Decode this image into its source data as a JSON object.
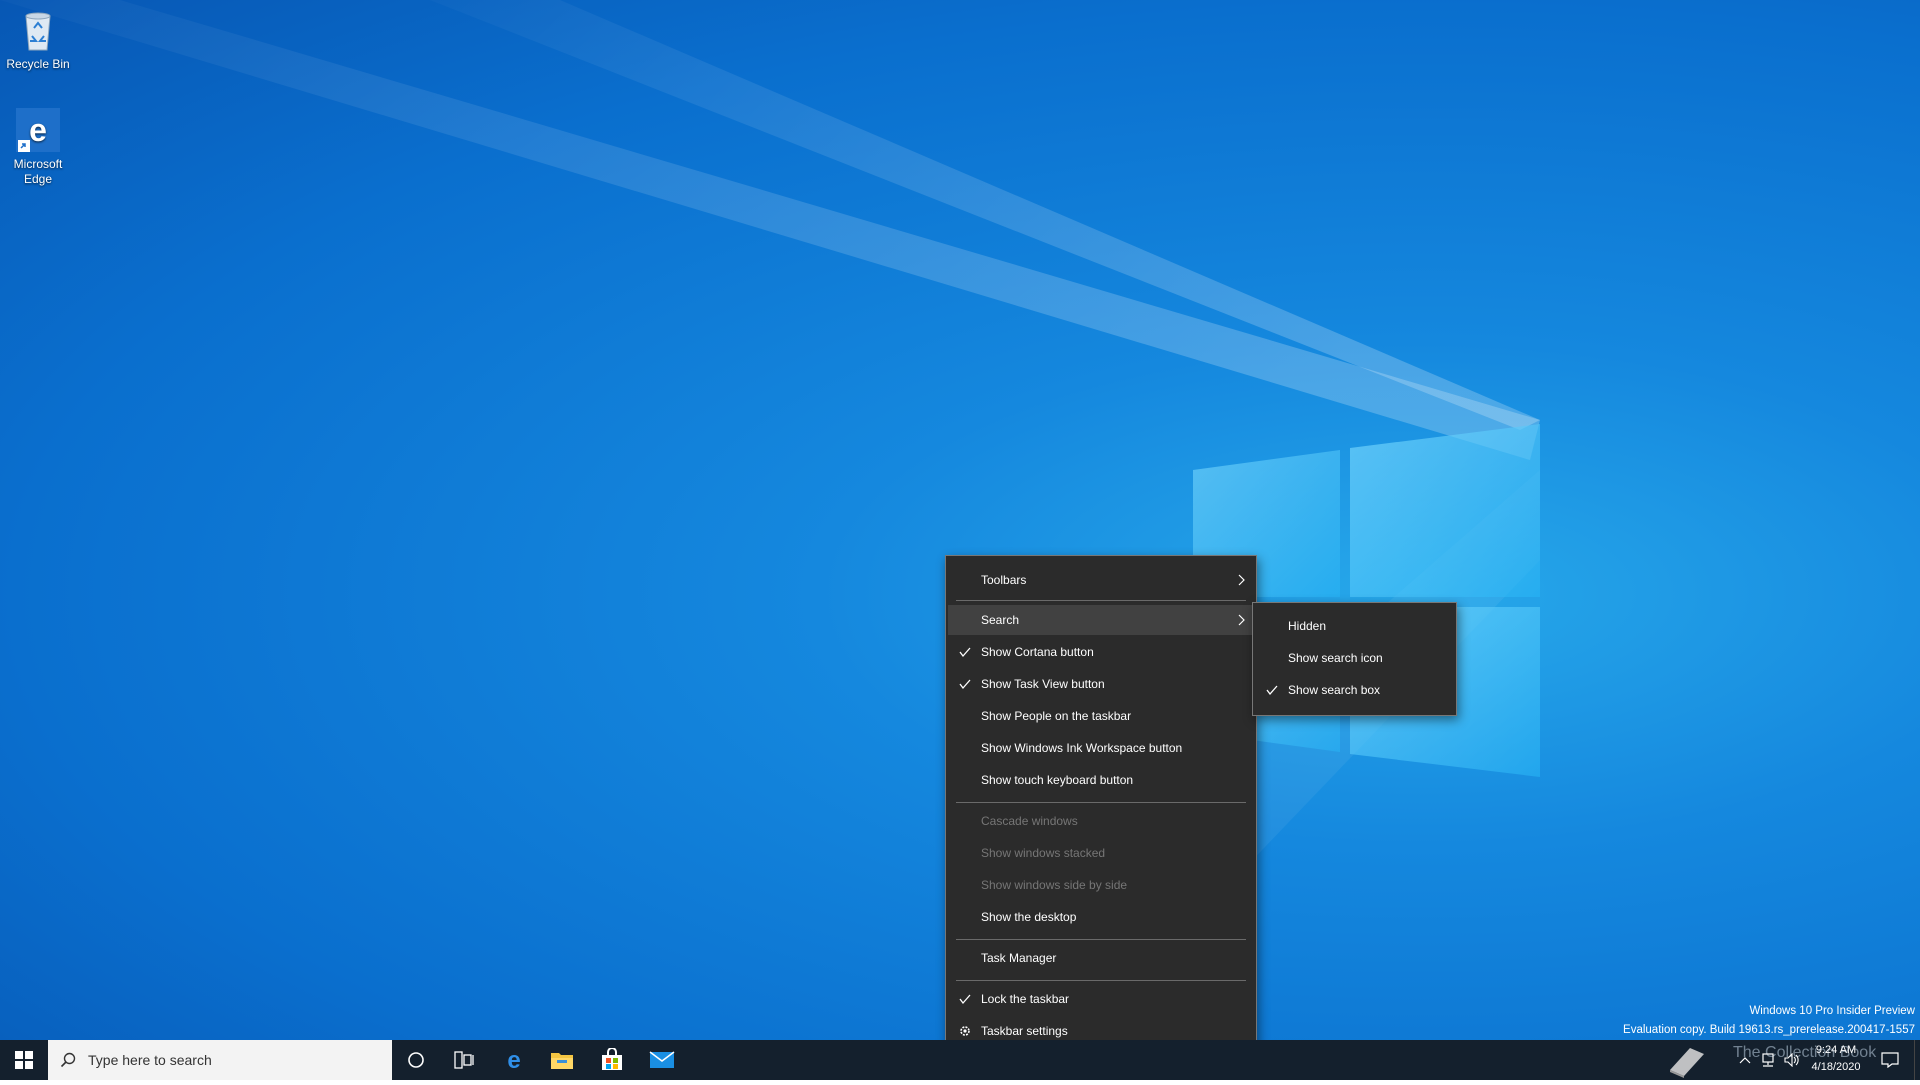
{
  "desktop": {
    "icons": [
      {
        "label": "Recycle Bin",
        "icon": "recycle-bin-icon"
      },
      {
        "label": "Microsoft Edge",
        "icon": "edge-icon"
      }
    ],
    "watermark": {
      "line1": "Windows 10 Pro Insider Preview",
      "line2": "Evaluation copy. Build 19613.rs_prerelease.200417-1557"
    },
    "overlay_text": "The Collection Book"
  },
  "context_menu": {
    "items": [
      {
        "label": "Toolbars",
        "submenu": true
      },
      {
        "label": "Search",
        "submenu": true,
        "highlighted": true
      },
      {
        "label": "Show Cortana button",
        "checked": true
      },
      {
        "label": "Show Task View button",
        "checked": true
      },
      {
        "label": "Show People on the taskbar"
      },
      {
        "label": "Show Windows Ink Workspace button"
      },
      {
        "label": "Show touch keyboard button"
      },
      {
        "label": "Cascade windows",
        "disabled": true
      },
      {
        "label": "Show windows stacked",
        "disabled": true
      },
      {
        "label": "Show windows side by side",
        "disabled": true
      },
      {
        "label": "Show the desktop"
      },
      {
        "label": "Task Manager"
      },
      {
        "label": "Lock the taskbar",
        "checked": true
      },
      {
        "label": "Taskbar settings",
        "icon": "gear-icon"
      }
    ]
  },
  "search_submenu": {
    "items": [
      {
        "label": "Hidden"
      },
      {
        "label": "Show search icon"
      },
      {
        "label": "Show search box",
        "checked": true
      }
    ]
  },
  "taskbar": {
    "search_placeholder": "Type here to search",
    "clock": {
      "time": "9:24 AM",
      "date": "4/18/2020"
    },
    "pinned_apps": [
      "edge-icon",
      "file-explorer-icon",
      "store-icon",
      "mail-icon"
    ]
  },
  "colors": {
    "menu_bg": "#2b2b2b",
    "menu_highlight": "#414141",
    "menu_disabled": "#767676",
    "taskbar_bg": "#14202d",
    "desktop_blue": "#0a6fce"
  }
}
